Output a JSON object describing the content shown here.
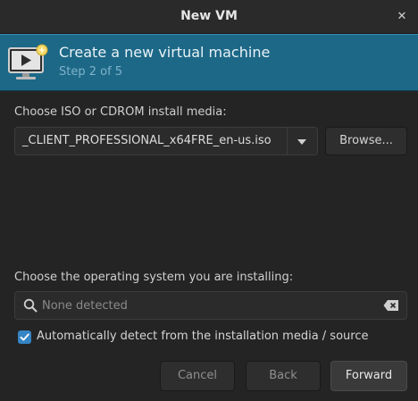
{
  "window": {
    "title": "New VM",
    "close_icon": "close-icon"
  },
  "banner": {
    "icon": "virtual-machine-icon",
    "title": "Create a new virtual machine",
    "step": "Step 2 of 5",
    "color": "#1d6887"
  },
  "install_media": {
    "label": "Choose ISO or CDROM install media:",
    "value": "_CLIENT_PROFESSIONAL_x64FRE_en-us.iso",
    "dropdown_icon": "chevron-down-icon",
    "browse_label": "Browse..."
  },
  "os_select": {
    "label": "Choose the operating system you are installing:",
    "placeholder": "None detected",
    "search_icon": "search-icon",
    "clear_icon": "backspace-clear-icon"
  },
  "auto_detect": {
    "checked": true,
    "label": "Automatically detect from the installation media / source",
    "accent": "#3584c4"
  },
  "buttons": {
    "cancel": "Cancel",
    "back": "Back",
    "forward": "Forward"
  }
}
